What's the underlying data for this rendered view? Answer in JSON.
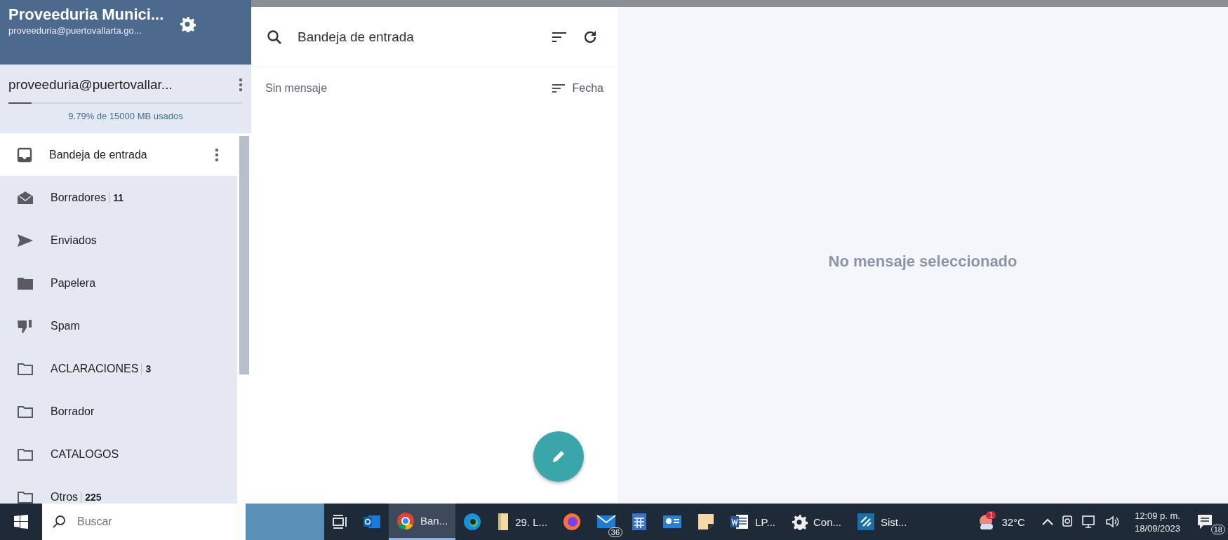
{
  "sidebar": {
    "account_title": "Proveeduria Munici...",
    "account_subtitle": "proveeduria@puertovallarta.go...",
    "account_name": "proveeduria@puertovallar...",
    "storage": {
      "level": 0.0979,
      "text": "9.79% de 15000 MB usados"
    },
    "folders": [
      {
        "kind": "inbox",
        "name": "Bandeja de entrada",
        "selected": true
      },
      {
        "kind": "drafts",
        "name": "Borradores",
        "count": "11",
        "selected": false
      },
      {
        "kind": "sent",
        "name": "Enviados",
        "selected": false
      },
      {
        "kind": "trash",
        "name": "Papelera",
        "selected": false
      },
      {
        "kind": "spam",
        "name": "Spam",
        "selected": false
      },
      {
        "kind": "folder",
        "name": "ACLARACIONES",
        "count": "3",
        "selected": false
      },
      {
        "kind": "folder",
        "name": "Borrador",
        "selected": false
      },
      {
        "kind": "folder",
        "name": "CATALOGOS",
        "selected": false
      },
      {
        "kind": "folder",
        "name": "Otros",
        "count": "225",
        "selected": false
      }
    ]
  },
  "message_list": {
    "folder_title": "Bandeja de entrada",
    "empty_text": "Sin mensaje",
    "sort_label": "Fecha"
  },
  "reading_pane": {
    "empty_text": "No mensaje seleccionado"
  },
  "taskbar": {
    "search_placeholder": "Buscar",
    "apps": [
      {
        "kind": "task-view",
        "active": false
      },
      {
        "kind": "outlook",
        "active": false
      },
      {
        "kind": "chrome",
        "label": "Ban...",
        "active": true
      },
      {
        "kind": "edge",
        "active": false
      },
      {
        "kind": "files",
        "label": "29. L...",
        "active": false
      },
      {
        "kind": "firefox",
        "active": false
      },
      {
        "kind": "mail",
        "badge": "36",
        "active": false
      },
      {
        "kind": "calculator",
        "active": false
      },
      {
        "kind": "contact",
        "active": false
      },
      {
        "kind": "sticky-notes",
        "active": false
      },
      {
        "kind": "word",
        "label": "LP...",
        "active": false
      },
      {
        "kind": "settings",
        "label": "Con...",
        "active": false
      },
      {
        "kind": "app",
        "label": "Sist...",
        "active": false
      }
    ],
    "weather": {
      "badge": "1",
      "temperature": "32°C"
    },
    "clock": {
      "time": "12:09 p. m.",
      "date": "18/09/2023"
    },
    "notifications": {
      "count": "18"
    }
  }
}
